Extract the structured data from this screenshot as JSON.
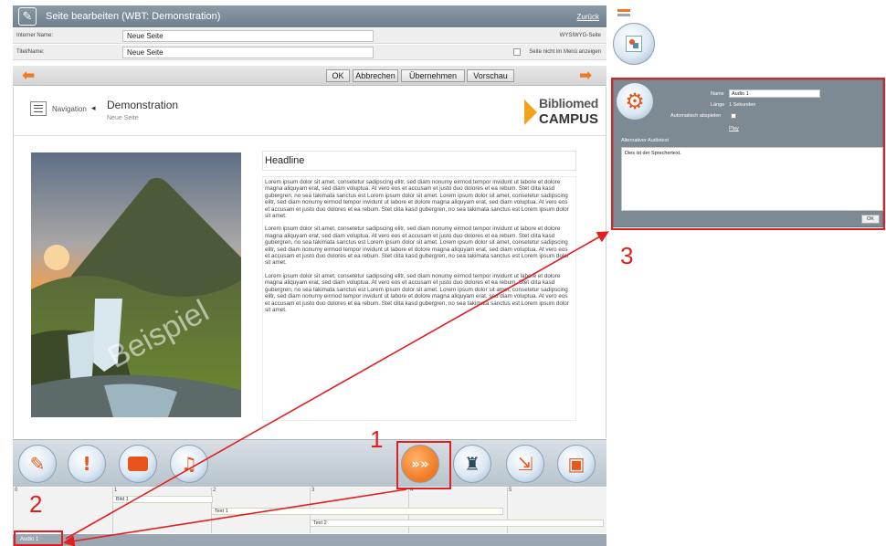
{
  "titlebar": {
    "title": "Seite bearbeiten (WBT: Demonstration)",
    "back_link": "Zurück"
  },
  "fields": {
    "internal_name": {
      "label": "Interner Name:",
      "value": "Neue Seite",
      "right_text": "WYSIWYG-Seite"
    },
    "title_name": {
      "label": "Titel/Name:",
      "value": "Neue Seite",
      "right_text": "Seite nicht im Menü anzeigen"
    }
  },
  "buttons": {
    "ok": "OK",
    "cancel": "Abbrechen",
    "apply": "Übernehmen",
    "preview": "Vorschau"
  },
  "preview": {
    "nav_label": "Navigation",
    "course_title": "Demonstration",
    "page_subtitle": "Neue Seite",
    "logo_line1": "Bibliomed",
    "logo_line2": "CAMPUS",
    "watermark": "Beispiel",
    "headline": "Headline",
    "paragraphs": [
      "Lorem ipsum dolor sit amet, consetetur sadipscing elitr, sed diam nonumy eirmod tempor invidunt ut labore et dolore magna aliquyam erat, sed diam voluptua. At vero eos et accusam et justo duo dolores et ea rebum. Stet clita kasd gubergren, no sea takimata sanctus est Lorem ipsum dolor sit amet. Lorem ipsum dolor sit amet, consetetur sadipscing elitr, sed diam nonumy eirmod tempor invidunt ut labore et dolore magna aliquyam erat, sed diam voluptua. At vero eos et accusam et justo duo dolores et ea rebum. Stet clita kasd gubergren, no sea takimata sanctus est Lorem ipsum dolor sit amet.",
      "Lorem ipsum dolor sit amet, consetetur sadipscing elitr, sed diam nonumy eirmod tempor invidunt ut labore et dolore magna aliquyam erat, sed diam voluptua. At vero eos et accusam et justo duo dolores et ea rebum. Stet clita kasd gubergren, no sea takimata sanctus est Lorem ipsum dolor sit amet. Lorem ipsum dolor sit amet, consetetur sadipscing elitr, sed diam nonumy eirmod tempor invidunt ut labore et dolore magna aliquyam erat, sed diam voluptua. At vero eos et accusam et justo duo dolores et ea rebum. Stet clita kasd gubergren, no sea takimata sanctus est Lorem ipsum dolor sit amet.",
      "Lorem ipsum dolor sit amet, consetetur sadipscing elitr, sed diam nonumy eirmod tempor invidunt ut labore et dolore magna aliquyam erat, sed diam voluptua. At vero eos et accusam et justo duo dolores et ea rebum. Stet clita kasd gubergren, no sea takimata sanctus est Lorem ipsum dolor sit amet. Lorem ipsum dolor sit amet, consetetur sadipscing elitr, sed diam nonumy eirmod tempor invidunt ut labore et dolore magna aliquyam erat, sed diam voluptua. At vero eos et accusam et justo duo dolores et ea rebum. Stet clita kasd gubergren, no sea takimata sanctus est Lorem ipsum dolor sit amet."
    ]
  },
  "timeline": {
    "ticks": [
      "0",
      "1",
      "2",
      "3",
      "4",
      "5"
    ],
    "tracks": [
      "Bild 1",
      "Text 1",
      "Text 2"
    ],
    "status_item": "Audio 1"
  },
  "audio_panel": {
    "name_label": "Name",
    "name_value": "Audio 1",
    "length_label": "Länge",
    "length_value": "1 Sekunden",
    "autoplay_label": "Automatisch abspielen",
    "file_link": "Play",
    "alt_text_label": "Alternativer Audiotext",
    "alt_text_value": "Dies ist der Sprechertext.",
    "ok_label": "OK"
  },
  "annotations": {
    "one": "1",
    "two": "2",
    "three": "3"
  },
  "colors": {
    "accent_orange": "#f07820",
    "annotation_red": "#e02020",
    "panel_gray": "#7d8993"
  },
  "icons": [
    "pen-icon",
    "back-arrow-icon",
    "forward-arrow-icon",
    "edit-icon",
    "exclamation-icon",
    "block-icon",
    "music-icon",
    "forward-chevrons-icon",
    "lamp-icon",
    "export-icon",
    "save-icon",
    "gear-icon",
    "image-icon"
  ]
}
